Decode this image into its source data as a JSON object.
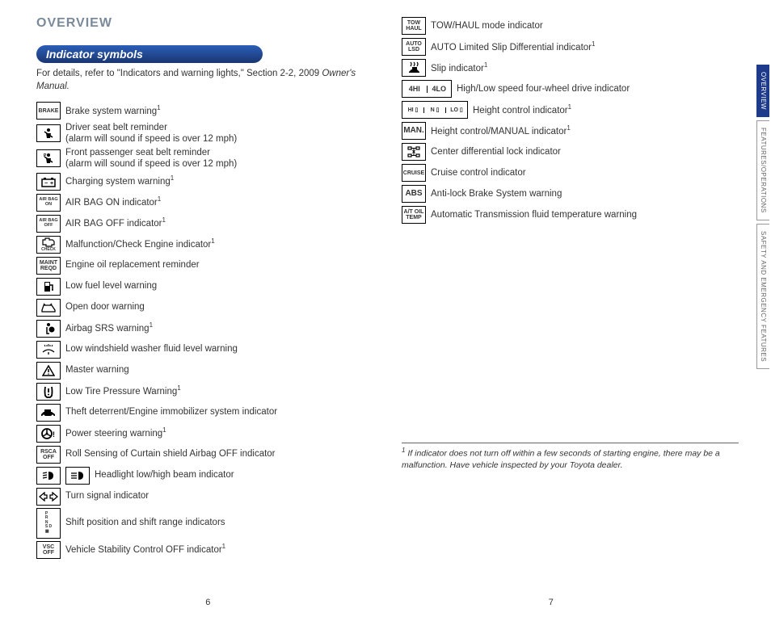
{
  "overview_label": "OVERVIEW",
  "section_title": "Indicator symbols",
  "intro_prefix": "For details, refer to \"Indicators and warning lights,\" Section 2-2, 2009 ",
  "intro_manual": "Owner's Manual.",
  "left": [
    {
      "icon": "BRAKE",
      "type": "text",
      "text": "Brake system warning",
      "sup": "1"
    },
    {
      "icon": "seatbelt",
      "type": "svg",
      "text": "Driver seat belt reminder\n(alarm will sound if speed is over 12 mph)"
    },
    {
      "icon": "seatbelt-p",
      "type": "svg",
      "text": "Front passenger seat belt reminder\n(alarm will sound if speed is over 12 mph)"
    },
    {
      "icon": "battery",
      "type": "svg",
      "text": "Charging system warning",
      "sup": "1"
    },
    {
      "icon": "AIR BAG\nON",
      "type": "text",
      "small": true,
      "text": "AIR BAG ON indicator",
      "sup": "1"
    },
    {
      "icon": "AIR BAG\nOFF",
      "type": "text",
      "small": true,
      "text": "AIR BAG OFF indicator",
      "sup": "1"
    },
    {
      "icon": "engine-check",
      "type": "svg",
      "sub": "CHECK",
      "text": "Malfunction/Check Engine indicator",
      "sup": "1"
    },
    {
      "icon": "MAINT\nREQD",
      "type": "text",
      "text": "Engine oil replacement reminder"
    },
    {
      "icon": "fuel",
      "type": "svg",
      "text": "Low fuel level warning"
    },
    {
      "icon": "door",
      "type": "svg",
      "text": "Open door warning"
    },
    {
      "icon": "airbag-srs",
      "type": "svg",
      "text": "Airbag SRS warning",
      "sup": "1"
    },
    {
      "icon": "washer",
      "type": "svg",
      "text": "Low windshield washer fluid level warning"
    },
    {
      "icon": "master",
      "type": "svg",
      "text": "Master warning"
    },
    {
      "icon": "tire",
      "type": "svg",
      "text": "Low Tire Pressure Warning",
      "sup": "1"
    },
    {
      "icon": "car-key",
      "type": "svg",
      "text": "Theft deterrent/Engine immobilizer system indicator"
    },
    {
      "icon": "steering",
      "type": "svg",
      "text": "Power steering warning",
      "sup": "1"
    },
    {
      "icon": "RSCA\nOFF",
      "type": "text",
      "text": "Roll Sensing of Curtain shield Airbag OFF indicator"
    },
    {
      "icon": "headlight",
      "type": "double-svg",
      "text": "Headlight low/high beam indicator"
    },
    {
      "icon": "turn",
      "type": "svg",
      "text": "Turn signal indicator"
    },
    {
      "icon": "shift",
      "type": "shift",
      "text": "Shift position and shift range indicators"
    },
    {
      "icon": "VSC\nOFF",
      "type": "text",
      "text": "Vehicle Stability Control OFF indicator",
      "sup": "1"
    }
  ],
  "right": [
    {
      "icon": "TOW\nHAUL",
      "type": "text",
      "text": "TOW/HAUL mode indicator"
    },
    {
      "icon": "AUTO\nLSD",
      "type": "text",
      "text": "AUTO Limited Slip Differential indicator",
      "sup": "1"
    },
    {
      "icon": "slip",
      "type": "svg",
      "text": "Slip indicator",
      "sup": "1"
    },
    {
      "icon": "4HI|4LO",
      "type": "split",
      "text": "High/Low speed four-wheel drive indicator"
    },
    {
      "icon": "HI ▯|N ▯|LO ▯",
      "type": "triple",
      "text": "Height control indicator",
      "sup": "1"
    },
    {
      "icon": "MAN.",
      "type": "text",
      "bold": true,
      "text": "Height control/MANUAL indicator",
      "sup": "1"
    },
    {
      "icon": "diff-lock",
      "type": "svg",
      "text": "Center differential lock indicator"
    },
    {
      "icon": "CRUISE",
      "type": "text",
      "text": "Cruise control indicator"
    },
    {
      "icon": "ABS",
      "type": "text",
      "bold": true,
      "text": "Anti-lock Brake System warning"
    },
    {
      "icon": "A/T OIL\nTEMP",
      "type": "text",
      "text": "Automatic Transmission fluid temperature warning"
    }
  ],
  "footnote_sup": "1",
  "footnote": " If indicator does not turn off within a few seconds of starting engine, there may be a malfunction. Have vehicle inspected by your Toyota dealer.",
  "page_left": "6",
  "page_right": "7",
  "tabs": [
    "OVERVIEW",
    "FEATURES/OPERATIONS",
    "SAFETY AND EMERGENCY FEATURES"
  ]
}
